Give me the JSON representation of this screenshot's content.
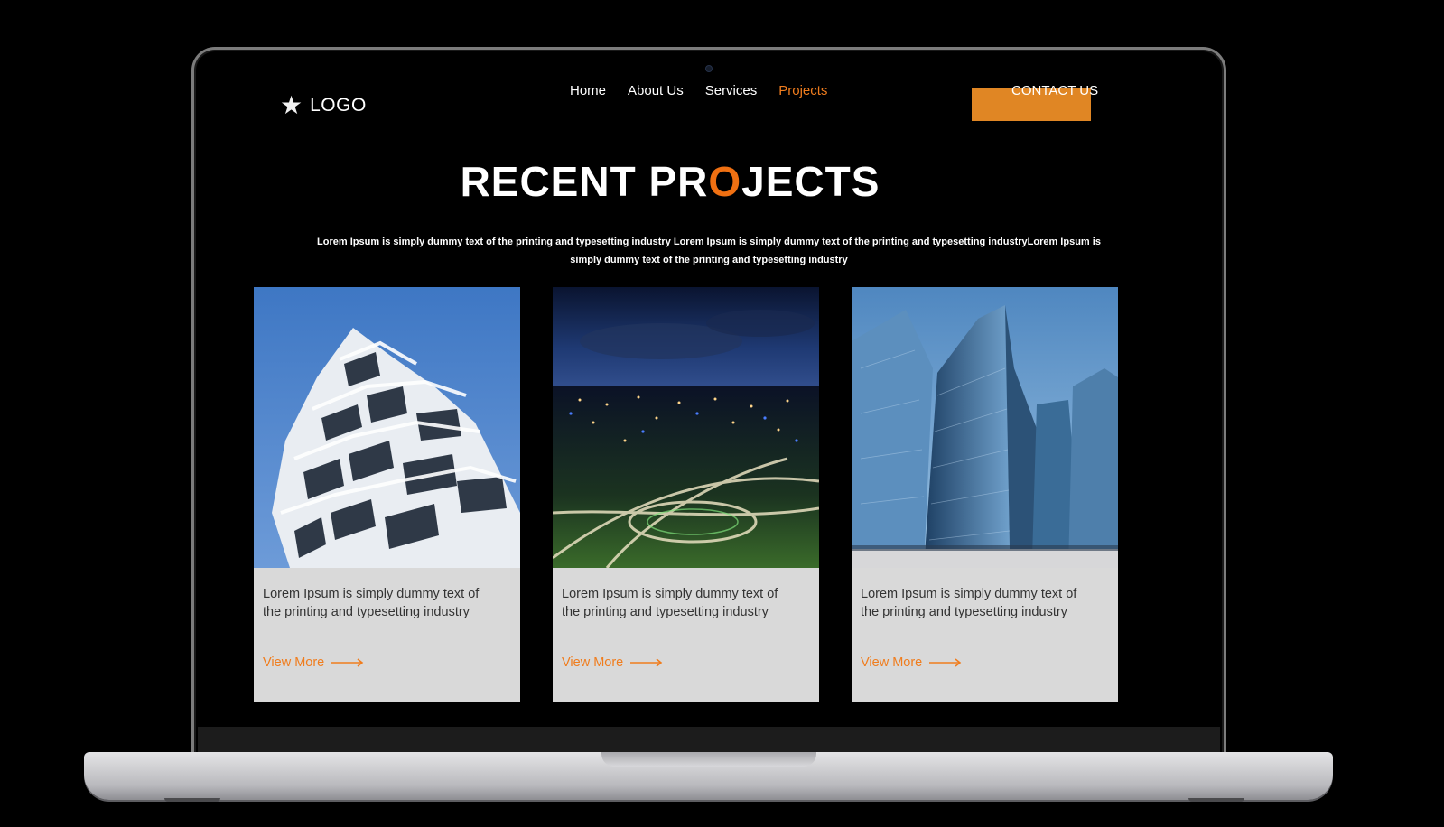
{
  "header": {
    "logo_text": "LOGO",
    "nav": [
      {
        "label": "Home",
        "active": false
      },
      {
        "label": "About Us",
        "active": false
      },
      {
        "label": "Services",
        "active": false
      },
      {
        "label": "Projects",
        "active": true
      }
    ],
    "cta_label": "CONTACT US"
  },
  "hero": {
    "title_before": "RECENT PR",
    "title_highlight": "O",
    "title_after": "JECTS",
    "intro": "Lorem Ipsum is simply dummy text of the printing and typesetting industry Lorem Ipsum is simply dummy text of the printing and typesetting industryLorem Ipsum is simply dummy text of the printing and typesetting industry"
  },
  "cards": [
    {
      "image": "apartment-building-photo",
      "text": "Lorem Ipsum is simply dummy text of the printing and typesetting industry",
      "link": "View More"
    },
    {
      "image": "city-night-highway-photo",
      "text": "Lorem Ipsum is simply dummy text of the printing and typesetting industry",
      "link": "View More"
    },
    {
      "image": "glass-skyscrapers-photo",
      "text": "Lorem Ipsum is simply dummy text of the printing and typesetting industry",
      "link": "View More"
    }
  ],
  "colors": {
    "accent": "#f07d1e",
    "cta": "#e08624",
    "card_bg": "#d9d9d9",
    "screen_bg": "#000000"
  }
}
